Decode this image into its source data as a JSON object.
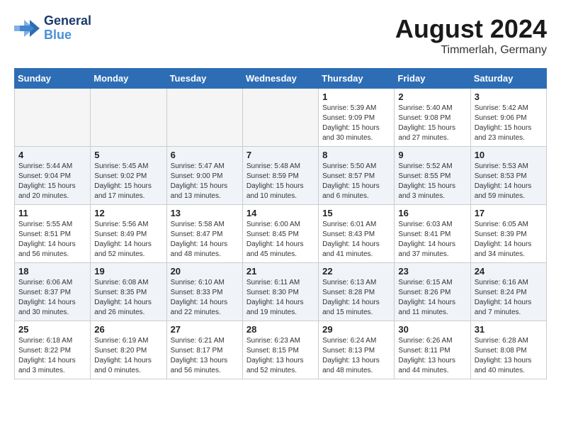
{
  "header": {
    "logo_line1": "General",
    "logo_line2": "Blue",
    "month_year": "August 2024",
    "location": "Timmerlah, Germany"
  },
  "weekdays": [
    "Sunday",
    "Monday",
    "Tuesday",
    "Wednesday",
    "Thursday",
    "Friday",
    "Saturday"
  ],
  "weeks": [
    [
      {
        "day": "",
        "info": ""
      },
      {
        "day": "",
        "info": ""
      },
      {
        "day": "",
        "info": ""
      },
      {
        "day": "",
        "info": ""
      },
      {
        "day": "1",
        "info": "Sunrise: 5:39 AM\nSunset: 9:09 PM\nDaylight: 15 hours\nand 30 minutes."
      },
      {
        "day": "2",
        "info": "Sunrise: 5:40 AM\nSunset: 9:08 PM\nDaylight: 15 hours\nand 27 minutes."
      },
      {
        "day": "3",
        "info": "Sunrise: 5:42 AM\nSunset: 9:06 PM\nDaylight: 15 hours\nand 23 minutes."
      }
    ],
    [
      {
        "day": "4",
        "info": "Sunrise: 5:44 AM\nSunset: 9:04 PM\nDaylight: 15 hours\nand 20 minutes."
      },
      {
        "day": "5",
        "info": "Sunrise: 5:45 AM\nSunset: 9:02 PM\nDaylight: 15 hours\nand 17 minutes."
      },
      {
        "day": "6",
        "info": "Sunrise: 5:47 AM\nSunset: 9:00 PM\nDaylight: 15 hours\nand 13 minutes."
      },
      {
        "day": "7",
        "info": "Sunrise: 5:48 AM\nSunset: 8:59 PM\nDaylight: 15 hours\nand 10 minutes."
      },
      {
        "day": "8",
        "info": "Sunrise: 5:50 AM\nSunset: 8:57 PM\nDaylight: 15 hours\nand 6 minutes."
      },
      {
        "day": "9",
        "info": "Sunrise: 5:52 AM\nSunset: 8:55 PM\nDaylight: 15 hours\nand 3 minutes."
      },
      {
        "day": "10",
        "info": "Sunrise: 5:53 AM\nSunset: 8:53 PM\nDaylight: 14 hours\nand 59 minutes."
      }
    ],
    [
      {
        "day": "11",
        "info": "Sunrise: 5:55 AM\nSunset: 8:51 PM\nDaylight: 14 hours\nand 56 minutes."
      },
      {
        "day": "12",
        "info": "Sunrise: 5:56 AM\nSunset: 8:49 PM\nDaylight: 14 hours\nand 52 minutes."
      },
      {
        "day": "13",
        "info": "Sunrise: 5:58 AM\nSunset: 8:47 PM\nDaylight: 14 hours\nand 48 minutes."
      },
      {
        "day": "14",
        "info": "Sunrise: 6:00 AM\nSunset: 8:45 PM\nDaylight: 14 hours\nand 45 minutes."
      },
      {
        "day": "15",
        "info": "Sunrise: 6:01 AM\nSunset: 8:43 PM\nDaylight: 14 hours\nand 41 minutes."
      },
      {
        "day": "16",
        "info": "Sunrise: 6:03 AM\nSunset: 8:41 PM\nDaylight: 14 hours\nand 37 minutes."
      },
      {
        "day": "17",
        "info": "Sunrise: 6:05 AM\nSunset: 8:39 PM\nDaylight: 14 hours\nand 34 minutes."
      }
    ],
    [
      {
        "day": "18",
        "info": "Sunrise: 6:06 AM\nSunset: 8:37 PM\nDaylight: 14 hours\nand 30 minutes."
      },
      {
        "day": "19",
        "info": "Sunrise: 6:08 AM\nSunset: 8:35 PM\nDaylight: 14 hours\nand 26 minutes."
      },
      {
        "day": "20",
        "info": "Sunrise: 6:10 AM\nSunset: 8:33 PM\nDaylight: 14 hours\nand 22 minutes."
      },
      {
        "day": "21",
        "info": "Sunrise: 6:11 AM\nSunset: 8:30 PM\nDaylight: 14 hours\nand 19 minutes."
      },
      {
        "day": "22",
        "info": "Sunrise: 6:13 AM\nSunset: 8:28 PM\nDaylight: 14 hours\nand 15 minutes."
      },
      {
        "day": "23",
        "info": "Sunrise: 6:15 AM\nSunset: 8:26 PM\nDaylight: 14 hours\nand 11 minutes."
      },
      {
        "day": "24",
        "info": "Sunrise: 6:16 AM\nSunset: 8:24 PM\nDaylight: 14 hours\nand 7 minutes."
      }
    ],
    [
      {
        "day": "25",
        "info": "Sunrise: 6:18 AM\nSunset: 8:22 PM\nDaylight: 14 hours\nand 3 minutes."
      },
      {
        "day": "26",
        "info": "Sunrise: 6:19 AM\nSunset: 8:20 PM\nDaylight: 14 hours\nand 0 minutes."
      },
      {
        "day": "27",
        "info": "Sunrise: 6:21 AM\nSunset: 8:17 PM\nDaylight: 13 hours\nand 56 minutes."
      },
      {
        "day": "28",
        "info": "Sunrise: 6:23 AM\nSunset: 8:15 PM\nDaylight: 13 hours\nand 52 minutes."
      },
      {
        "day": "29",
        "info": "Sunrise: 6:24 AM\nSunset: 8:13 PM\nDaylight: 13 hours\nand 48 minutes."
      },
      {
        "day": "30",
        "info": "Sunrise: 6:26 AM\nSunset: 8:11 PM\nDaylight: 13 hours\nand 44 minutes."
      },
      {
        "day": "31",
        "info": "Sunrise: 6:28 AM\nSunset: 8:08 PM\nDaylight: 13 hours\nand 40 minutes."
      }
    ]
  ]
}
